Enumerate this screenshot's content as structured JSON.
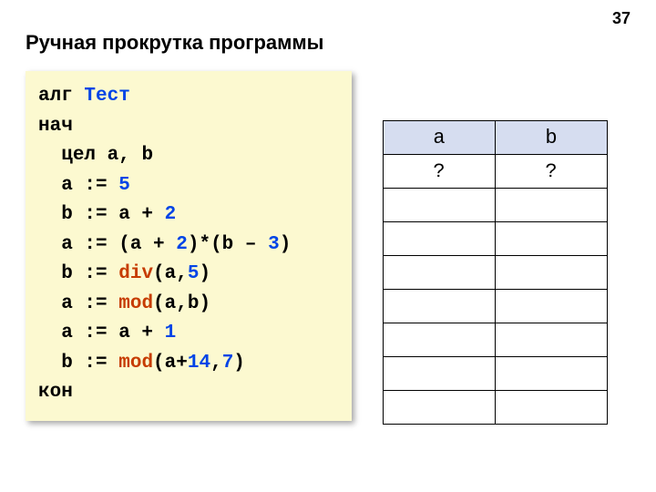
{
  "page_number": "37",
  "title": "Ручная прокрутка программы",
  "code": {
    "l1": {
      "kw": "алг ",
      "name": "Тест"
    },
    "l2": {
      "kw": "нач"
    },
    "l3": {
      "pad": "  ",
      "kw": "цел",
      "rest": " a, b"
    },
    "l4": {
      "pad": "  ",
      "lhs": "a := ",
      "n1": "5"
    },
    "l5": {
      "pad": "  ",
      "lhs": "b := a + ",
      "n1": "2"
    },
    "l6": {
      "pad": "  ",
      "lhs": "a := (a + ",
      "n1": "2",
      "mid": ")*(b – ",
      "n2": "3",
      "end": ")"
    },
    "l7": {
      "pad": "  ",
      "lhs": "b := ",
      "fn": "div",
      "args_open": "(a,",
      "n1": "5",
      "args_close": ")"
    },
    "l8": {
      "pad": "  ",
      "lhs": "a := ",
      "fn": "mod",
      "args": "(a,b)"
    },
    "l9": {
      "pad": "  ",
      "lhs": "a := a + ",
      "n1": "1"
    },
    "l10": {
      "pad": "  ",
      "lhs": "b := ",
      "fn": "mod",
      "args_open": "(a+",
      "n1": "14",
      "mid": ",",
      "n2": "7",
      "args_close": ")"
    },
    "l11": {
      "kw": "кон"
    }
  },
  "table": {
    "headers": [
      "a",
      "b"
    ],
    "rows": [
      [
        "?",
        "?"
      ],
      [
        "",
        ""
      ],
      [
        "",
        ""
      ],
      [
        "",
        ""
      ],
      [
        "",
        ""
      ],
      [
        "",
        ""
      ],
      [
        "",
        ""
      ],
      [
        "",
        ""
      ]
    ]
  }
}
